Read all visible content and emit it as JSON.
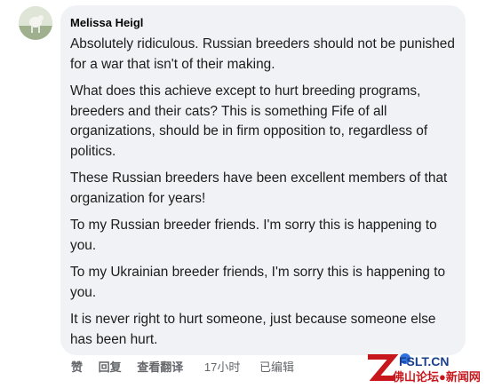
{
  "comment": {
    "author": "Melissa Heigl",
    "paragraphs": [
      "Absolutely ridiculous. Russian breeders should not be punished for a war that isn't of their making.",
      "What does this achieve except to hurt breeding programs, breeders and their cats? This is something Fife of all organizations, should be in firm opposition to, regardless of politics.",
      "These Russian breeders have been excellent members of that organization for years!",
      "To my Russian breeder friends. I'm sorry this is happening to you.",
      "To my Ukrainian breeder friends, I'm sorry this is happening to you.",
      "It is never right to hurt someone, just because someone else has been hurt."
    ]
  },
  "actions": {
    "like": "赞",
    "reply": "回复",
    "translate": "查看翻译",
    "time": "17小时",
    "edited": "已编辑"
  },
  "watermark": {
    "site": "FSLT.CN",
    "name": "佛山论坛●新闻网"
  },
  "colors": {
    "bubble_bg": "#f0f2f5",
    "text": "#050505",
    "meta": "#65676b",
    "watermark_red": "#c8171c",
    "watermark_blue": "#1a3f8a"
  }
}
